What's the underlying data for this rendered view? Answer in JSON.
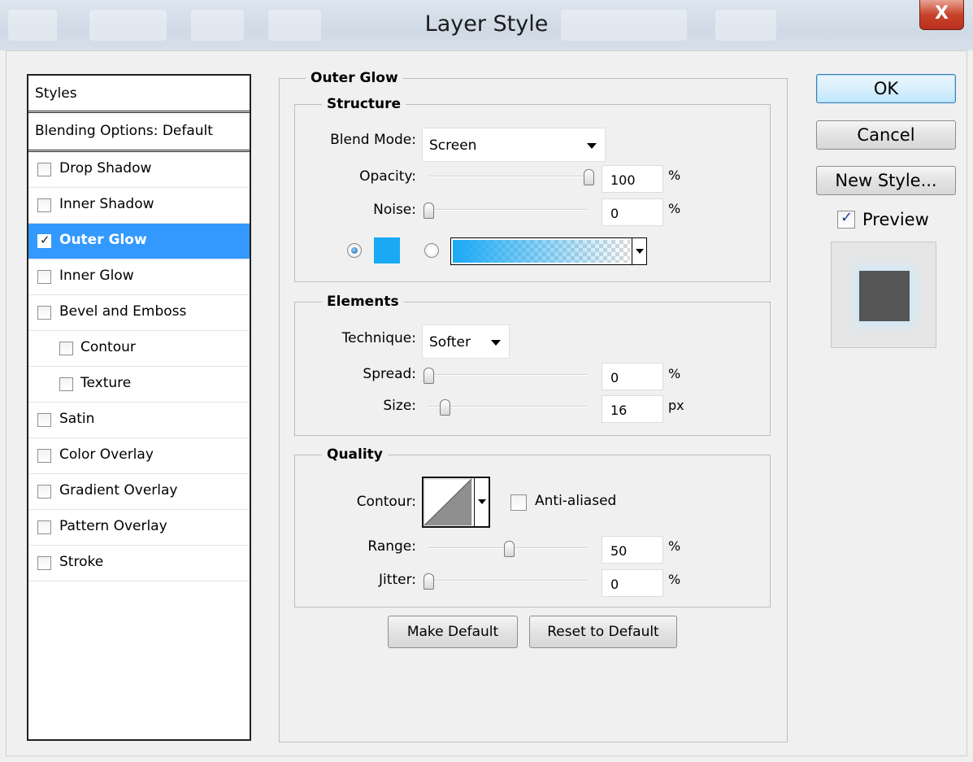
{
  "window": {
    "title": "Layer Style",
    "close_label": "X"
  },
  "styles_panel": {
    "header": "Styles",
    "blending_options": "Blending Options: Default",
    "items": [
      {
        "label": "Drop Shadow",
        "checked": false,
        "selected": false,
        "sub": false
      },
      {
        "label": "Inner Shadow",
        "checked": false,
        "selected": false,
        "sub": false
      },
      {
        "label": "Outer Glow",
        "checked": true,
        "selected": true,
        "sub": false
      },
      {
        "label": "Inner Glow",
        "checked": false,
        "selected": false,
        "sub": false
      },
      {
        "label": "Bevel and Emboss",
        "checked": false,
        "selected": false,
        "sub": false
      },
      {
        "label": "Contour",
        "checked": false,
        "selected": false,
        "sub": true
      },
      {
        "label": "Texture",
        "checked": false,
        "selected": false,
        "sub": true
      },
      {
        "label": "Satin",
        "checked": false,
        "selected": false,
        "sub": false
      },
      {
        "label": "Color Overlay",
        "checked": false,
        "selected": false,
        "sub": false
      },
      {
        "label": "Gradient Overlay",
        "checked": false,
        "selected": false,
        "sub": false
      },
      {
        "label": "Pattern Overlay",
        "checked": false,
        "selected": false,
        "sub": false
      },
      {
        "label": "Stroke",
        "checked": false,
        "selected": false,
        "sub": false
      }
    ]
  },
  "outer_glow": {
    "title": "Outer Glow",
    "structure": {
      "title": "Structure",
      "blend_mode_label": "Blend Mode:",
      "blend_mode_value": "Screen",
      "opacity_label": "Opacity:",
      "opacity_value": "100",
      "opacity_level": 1.0,
      "opacity_unit": "%",
      "noise_label": "Noise:",
      "noise_value": "0",
      "noise_level": 0.0,
      "noise_unit": "%",
      "solid_color": "#1aa9f5",
      "color_mode": "solid"
    },
    "elements": {
      "title": "Elements",
      "technique_label": "Technique:",
      "technique_value": "Softer",
      "spread_label": "Spread:",
      "spread_value": "0",
      "spread_level": 0.0,
      "spread_unit": "%",
      "size_label": "Size:",
      "size_value": "16",
      "size_level": 0.1,
      "size_unit": "px"
    },
    "quality": {
      "title": "Quality",
      "contour_label": "Contour:",
      "anti_aliased_label": "Anti-aliased",
      "anti_aliased": false,
      "range_label": "Range:",
      "range_value": "50",
      "range_level": 0.5,
      "range_unit": "%",
      "jitter_label": "Jitter:",
      "jitter_value": "0",
      "jitter_level": 0.0,
      "jitter_unit": "%"
    },
    "make_default_label": "Make Default",
    "reset_default_label": "Reset to Default"
  },
  "actions": {
    "ok_label": "OK",
    "cancel_label": "Cancel",
    "new_style_label": "New Style...",
    "preview_label": "Preview",
    "preview_checked": true
  }
}
